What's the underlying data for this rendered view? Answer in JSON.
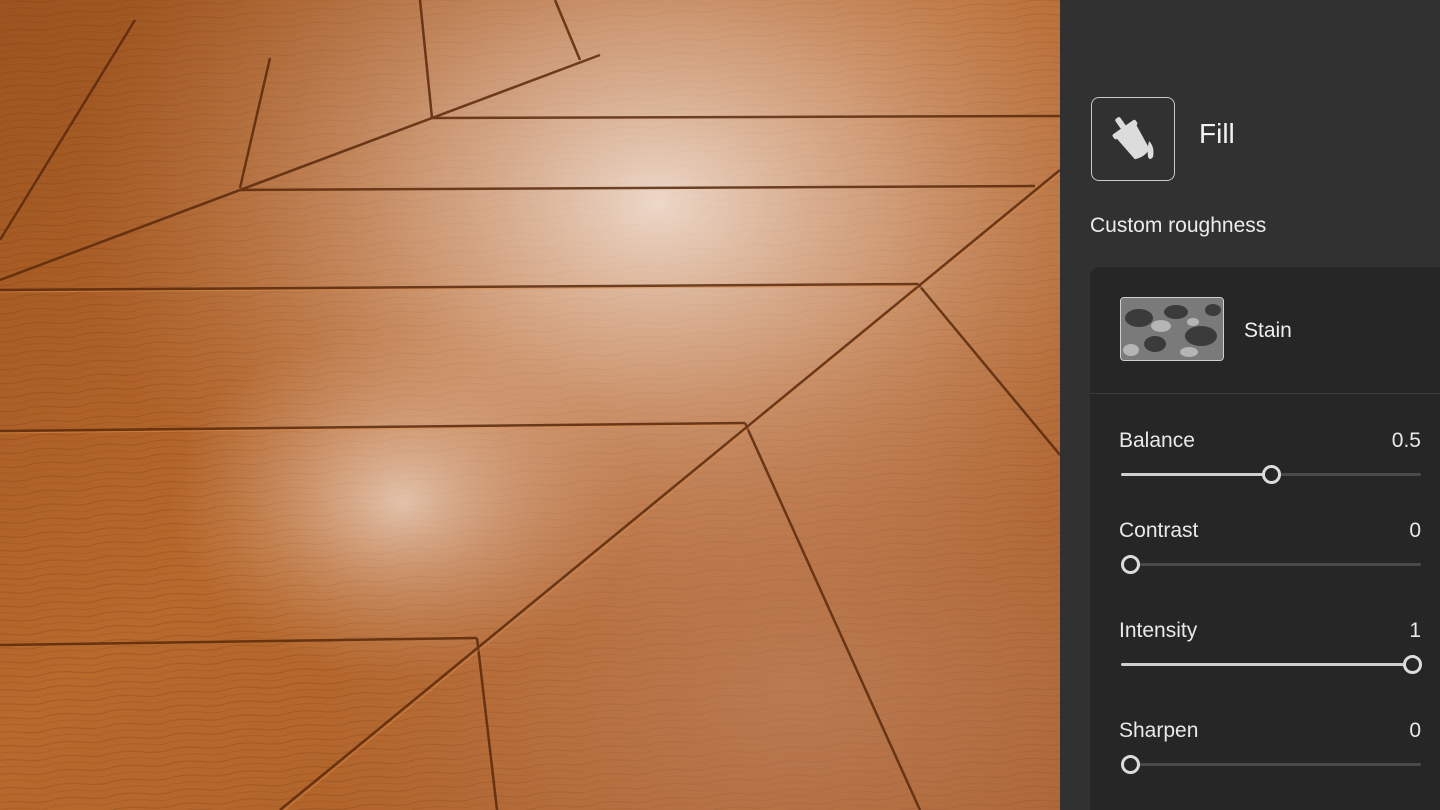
{
  "panel": {
    "tool_icon": "paint-bucket-icon",
    "tool_title": "Fill",
    "section_label": "Custom roughness",
    "texture": {
      "label": "Stain",
      "icon": "stain-texture-thumbnail"
    },
    "params": [
      {
        "name": "Balance",
        "value": "0.5",
        "level": 0.5
      },
      {
        "name": "Contrast",
        "value": "0",
        "level": 0
      },
      {
        "name": "Intensity",
        "value": "1",
        "level": 1
      },
      {
        "name": "Sharpen",
        "value": "0",
        "level": 0
      }
    ]
  },
  "colors": {
    "panel_bg": "#313131",
    "card_bg": "#262626",
    "wood_base": "#b0642a",
    "wood_dark": "#8a4a1c",
    "highlight": "#f3e3d8"
  }
}
